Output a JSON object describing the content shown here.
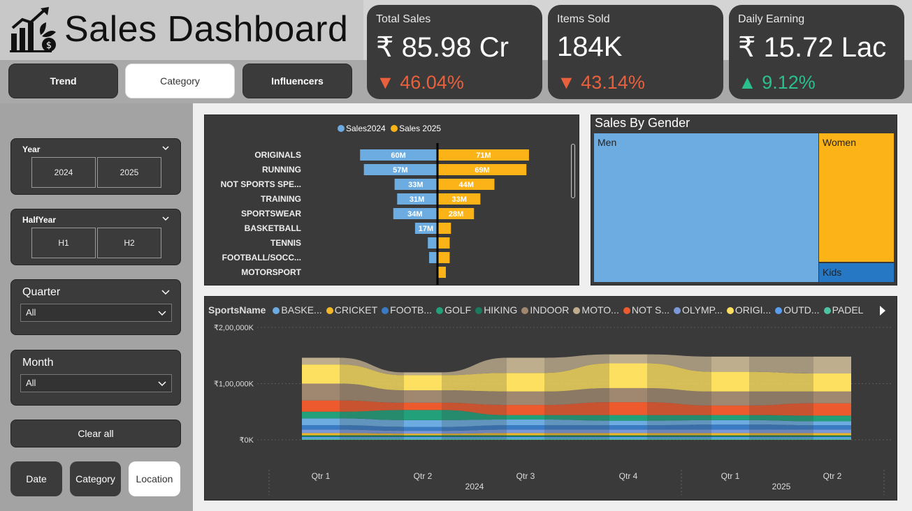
{
  "header": {
    "title": "Sales Dashboard",
    "logo": "growth-chart-icon"
  },
  "tabs": [
    {
      "label": "Trend",
      "active": false
    },
    {
      "label": "Category",
      "active": true
    },
    {
      "label": "Influencers",
      "active": false
    }
  ],
  "kpis": [
    {
      "label": "Total Sales",
      "value": "₹ 85.98 Cr",
      "arrow": "▼",
      "change": "46.04%",
      "direction": "down"
    },
    {
      "label": "Items Sold",
      "value": "184K",
      "arrow": "▼",
      "change": "43.14%",
      "direction": "down"
    },
    {
      "label": "Daily Earning",
      "value": "₹ 15.72 Lac",
      "arrow": "▲",
      "change": "9.12%",
      "direction": "up"
    }
  ],
  "filters": {
    "year": {
      "title": "Year",
      "options": [
        "2024",
        "2025"
      ]
    },
    "halfyear": {
      "title": "HalfYear",
      "options": [
        "H1",
        "H2"
      ]
    },
    "quarter": {
      "title": "Quarter",
      "selected": "All"
    },
    "month": {
      "title": "Month",
      "selected": "All"
    },
    "clear_label": "Clear all"
  },
  "nav": [
    {
      "label": "Date",
      "active": false
    },
    {
      "label": "Category",
      "active": false
    },
    {
      "label": "Location",
      "active": true
    }
  ],
  "colors": {
    "sales2024": "#6cace0",
    "sales2025": "#fbb317",
    "men": "#6cace0",
    "women": "#fbb317",
    "kids": "#2778c4",
    "down": "#e8603c",
    "up": "#2bbf8e"
  },
  "chart_data": [
    {
      "type": "bar",
      "subtype": "diverging-horizontal",
      "legend": [
        "Sales2024",
        "Sales 2025"
      ],
      "categories": [
        "ORIGINALS",
        "RUNNING",
        "NOT SPORTS SPE...",
        "TRAINING",
        "SPORTSWEAR",
        "BASKETBALL",
        "TENNIS",
        "FOOTBALL/SOCC...",
        "MOTORSPORT"
      ],
      "series": [
        {
          "name": "Sales2024",
          "values": [
            60,
            57,
            33,
            31,
            34,
            17,
            7,
            6,
            0
          ],
          "labels": [
            "60M",
            "57M",
            "33M",
            "31M",
            "34M",
            "17M",
            "",
            "",
            ""
          ]
        },
        {
          "name": "Sales 2025",
          "values": [
            71,
            69,
            44,
            33,
            28,
            10,
            9,
            9,
            6
          ],
          "labels": [
            "71M",
            "69M",
            "44M",
            "33M",
            "28M",
            "",
            "",
            "",
            ""
          ]
        }
      ],
      "unit": "M"
    },
    {
      "type": "treemap",
      "title": "Sales By Gender",
      "items": [
        {
          "label": "Men",
          "value": 62
        },
        {
          "label": "Women",
          "value": 28
        },
        {
          "label": "Kids",
          "value": 5
        }
      ]
    },
    {
      "type": "area",
      "subtype": "ribbon",
      "legend_title": "SportsName",
      "legend": [
        {
          "name": "BASKE...",
          "color": "#6cace0"
        },
        {
          "name": "CRICKET",
          "color": "#f2b82a"
        },
        {
          "name": "FOOTB...",
          "color": "#3a7cc4"
        },
        {
          "name": "GOLF",
          "color": "#22a07a"
        },
        {
          "name": "HIKING",
          "color": "#1a7a5e"
        },
        {
          "name": "INDOOR",
          "color": "#a08870"
        },
        {
          "name": "MOTO...",
          "color": "#bfae8e"
        },
        {
          "name": "NOT S...",
          "color": "#ec5a2e"
        },
        {
          "name": "OLYMP...",
          "color": "#7b98d8"
        },
        {
          "name": "ORIGI...",
          "color": "#fde060"
        },
        {
          "name": "OUTD...",
          "color": "#5a9ef0"
        },
        {
          "name": "PADEL",
          "color": "#4cc4a4"
        }
      ],
      "x": [
        "Qtr 1",
        "Qtr 2",
        "Qtr 3",
        "Qtr 4",
        "Qtr 1",
        "Qtr 2"
      ],
      "x_groups": [
        {
          "label": "2024",
          "span": [
            0,
            3
          ]
        },
        {
          "label": "2025",
          "span": [
            4,
            5
          ]
        }
      ],
      "y_ticks": [
        "₹0K",
        "₹1,00,000K",
        "₹2,00,000K"
      ],
      "ylim": [
        0,
        200000
      ],
      "stacks": [
        {
          "totals": [
            146000,
            120000,
            144000,
            152000,
            148000,
            148000
          ]
        }
      ],
      "series": [
        {
          "name": "PADEL",
          "color": "#4cc4a4",
          "values": [
            2000,
            2000,
            2000,
            2000,
            2000,
            2000
          ]
        },
        {
          "name": "OUTD...",
          "color": "#5a9ef0",
          "values": [
            3000,
            3000,
            3000,
            3000,
            3000,
            3000
          ]
        },
        {
          "name": "HIKING",
          "color": "#1a7a5e",
          "values": [
            3000,
            3000,
            3000,
            3000,
            3000,
            3000
          ]
        },
        {
          "name": "CRICKET",
          "color": "#f2b82a",
          "values": [
            4000,
            3000,
            4000,
            4000,
            4000,
            4000
          ]
        },
        {
          "name": "OLYMP...",
          "color": "#7b98d8",
          "values": [
            6000,
            5000,
            6000,
            6000,
            6000,
            6000
          ]
        },
        {
          "name": "FOOTB...",
          "color": "#3a7cc4",
          "values": [
            8000,
            7000,
            8000,
            8000,
            9000,
            8000
          ]
        },
        {
          "name": "BASKE...",
          "color": "#6cace0",
          "values": [
            12000,
            12000,
            10000,
            8000,
            8000,
            7000
          ]
        },
        {
          "name": "GOLF",
          "color": "#22a07a",
          "values": [
            12000,
            18000,
            8000,
            10000,
            9000,
            10000
          ]
        },
        {
          "name": "NOT S...",
          "color": "#ec5a2e",
          "values": [
            20000,
            13000,
            18000,
            23000,
            17000,
            22000
          ]
        },
        {
          "name": "INDOOR",
          "color": "#a08870",
          "values": [
            30000,
            22000,
            24000,
            25000,
            25000,
            21000
          ]
        },
        {
          "name": "ORIGI...",
          "color": "#fde060",
          "values": [
            34000,
            27000,
            33000,
            44000,
            35000,
            32000
          ]
        },
        {
          "name": "MOTO...",
          "color": "#bfae8e",
          "values": [
            12000,
            5000,
            27000,
            16000,
            27000,
            30000
          ]
        }
      ]
    }
  ]
}
